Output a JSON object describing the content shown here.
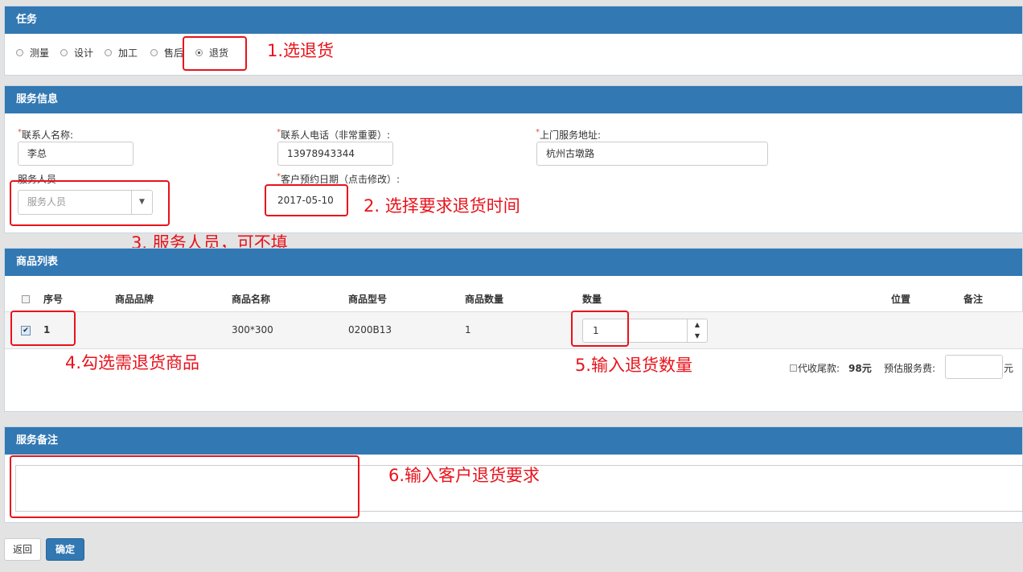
{
  "task": {
    "title": "任务",
    "options": [
      "测量",
      "设计",
      "加工",
      "售后",
      "退货"
    ],
    "selected": "退货"
  },
  "service_info": {
    "title": "服务信息",
    "contact_name_label": "联系人名称:",
    "contact_name_value": "李总",
    "contact_phone_label": "联系人电话（非常重要）:",
    "contact_phone_value": "13978943344",
    "address_label": "上门服务地址:",
    "address_value": "杭州古墩路",
    "staff_label": "服务人员",
    "staff_placeholder": "服务人员",
    "date_label": "客户预约日期（点击修改）:",
    "date_value": "2017-05-10"
  },
  "goods": {
    "title": "商品列表",
    "columns": [
      "序号",
      "商品品牌",
      "商品名称",
      "商品型号",
      "商品数量",
      "数量",
      "位置",
      "备注"
    ],
    "rows": [
      {
        "index": "1",
        "brand": "",
        "name": "300*300",
        "model": "0200B13",
        "count": "1",
        "qty": "1",
        "checked": true
      }
    ],
    "collect_label": "代收尾款:",
    "collect_value": "98元",
    "fee_label": "预估服务费:",
    "fee_unit": "元"
  },
  "remarks": {
    "title": "服务备注",
    "value": ""
  },
  "buttons": {
    "back": "返回",
    "confirm": "确定"
  },
  "annotations": {
    "a1": "1.选退货",
    "a2": "2. 选择要求退货时间",
    "a3": "3. 服务人员，可不填",
    "a4": "4.勾选需退货商品",
    "a5": "5.输入退货数量",
    "a6": "6.输入客户退货要求"
  },
  "colors": {
    "header": "#3278b3",
    "annotation": "#e8121b",
    "confirm_button": "#3278b3"
  }
}
